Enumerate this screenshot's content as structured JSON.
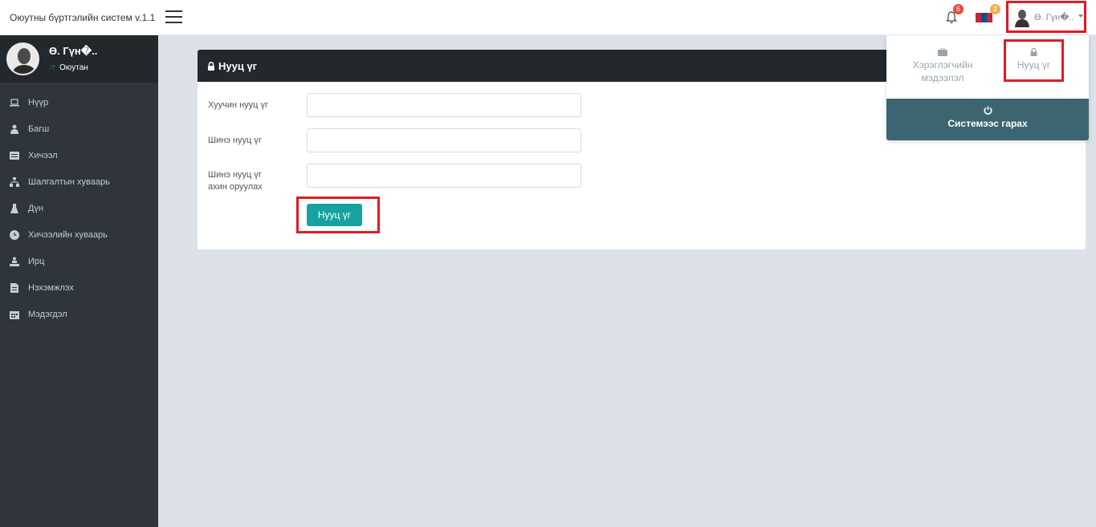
{
  "header": {
    "brand": "Оюутны бүртгэлийн систем v.1.1",
    "notifications_count": "6",
    "language_count": "2",
    "user_name": "Ө. Гүн�..",
    "icons": {
      "menu": "hamburger-icon",
      "bell": "bell-icon",
      "flag": "mongolia-flag-icon",
      "caret": "caret-down-icon"
    }
  },
  "sidebar": {
    "profile": {
      "name": "Ө. Гүн�..",
      "role": "Оюутан",
      "role_icon": "hand-point-icon"
    },
    "items": [
      {
        "label": "Нүүр",
        "icon": "laptop-icon"
      },
      {
        "label": "Багш",
        "icon": "teacher-icon"
      },
      {
        "label": "Хичээл",
        "icon": "book-icon"
      },
      {
        "label": "Шалгалтын хуваарь",
        "icon": "sitemap-icon"
      },
      {
        "label": "Дүн",
        "icon": "flask-icon"
      },
      {
        "label": "Хичээлийн хуваарь",
        "icon": "clock-icon"
      },
      {
        "label": "Ирц",
        "icon": "attendance-icon"
      },
      {
        "label": "Нэхэмжлэх",
        "icon": "invoice-icon"
      },
      {
        "label": "Мэдэгдэл",
        "icon": "calendar-icon"
      }
    ]
  },
  "password_form": {
    "title": "Нууц үг",
    "old_password_label": "Хуучин нууц үг",
    "new_password_label": "Шинэ нууц үг",
    "confirm_password_label": "Шинэ нууц үг ахин оруулах",
    "old_password_value": "",
    "new_password_value": "",
    "confirm_password_value": "",
    "submit_label": "Нууц үг"
  },
  "user_dropdown": {
    "info_label": "Хэрэглэгчийн мэдээлэл",
    "password_label": "Нууц үг",
    "logout_label": "Системээс гарах"
  },
  "colors": {
    "sidebar_bg": "#2f353b",
    "header_dark": "#23282d",
    "primary_button": "#17a2a0",
    "logout_bg": "#3d6471",
    "highlight": "#e01b24"
  }
}
